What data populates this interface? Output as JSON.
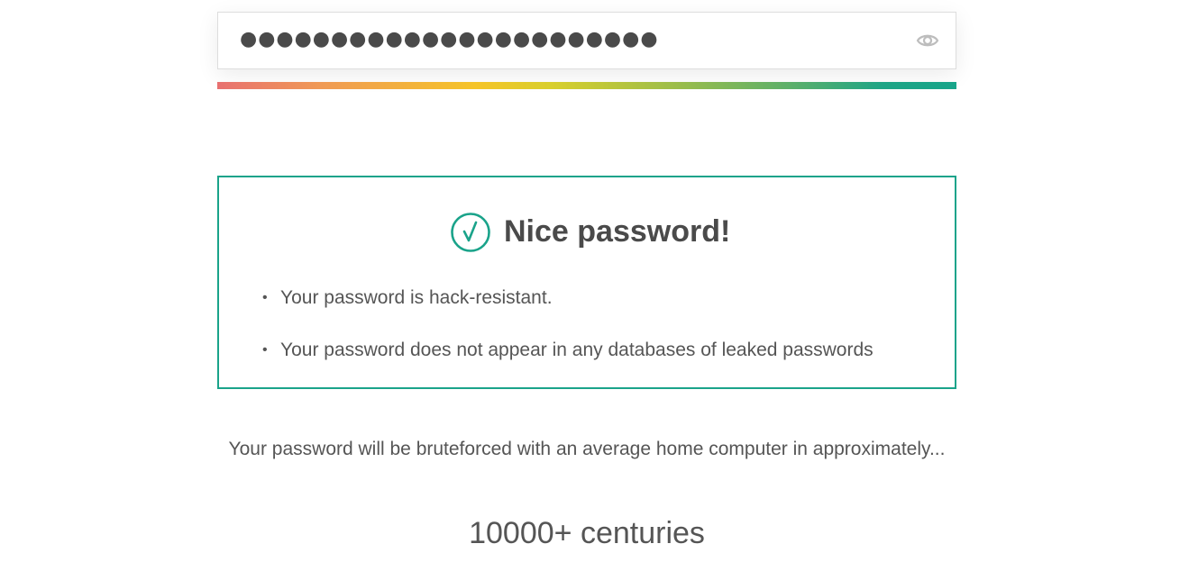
{
  "password_field": {
    "masked_value": "●●●●●●●●●●●●●●●●●●●●●●●",
    "toggle_icon": "eye-icon"
  },
  "strength": {
    "level": 1.0,
    "gradient_colors": [
      "#e87070",
      "#f09a55",
      "#f5c428",
      "#9cbd4a",
      "#1fa586"
    ]
  },
  "result": {
    "icon": "checkmark-circle-icon",
    "title": "Nice password!",
    "accent_color": "#1aa38a",
    "points": [
      "Your password is hack-resistant.",
      "Your password does not appear in any databases of leaked passwords"
    ]
  },
  "bruteforce": {
    "description": "Your password will be bruteforced with an average home computer in approximately...",
    "time": "10000+ centuries"
  }
}
